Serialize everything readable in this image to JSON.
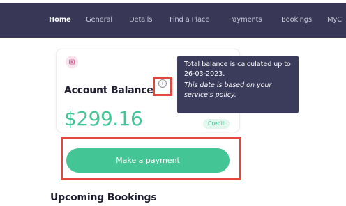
{
  "nav": {
    "items": [
      {
        "label": "Home",
        "active": true
      },
      {
        "label": "General",
        "active": false
      },
      {
        "label": "Details",
        "active": false
      },
      {
        "label": "Find a Place",
        "active": false
      },
      {
        "label": "Payments",
        "active": false
      },
      {
        "label": "Bookings",
        "active": false
      },
      {
        "label": "MyC",
        "active": false
      }
    ]
  },
  "account": {
    "icon": "card-icon",
    "title": "Account Balance",
    "info_icon_glyph": "i",
    "balance": "$299.16",
    "badge": "Credit"
  },
  "tooltip": {
    "line1": "Total balance is calculated up to 26-03-2023.",
    "line2": "This date is based on your service's policy."
  },
  "actions": {
    "make_payment_label": "Make a payment"
  },
  "sections": {
    "upcoming_title": "Upcoming Bookings"
  },
  "colors": {
    "nav_bg": "#383856",
    "accent_green": "#43c596",
    "highlight_red": "#e2463d",
    "tooltip_bg": "#3b3b5b"
  }
}
